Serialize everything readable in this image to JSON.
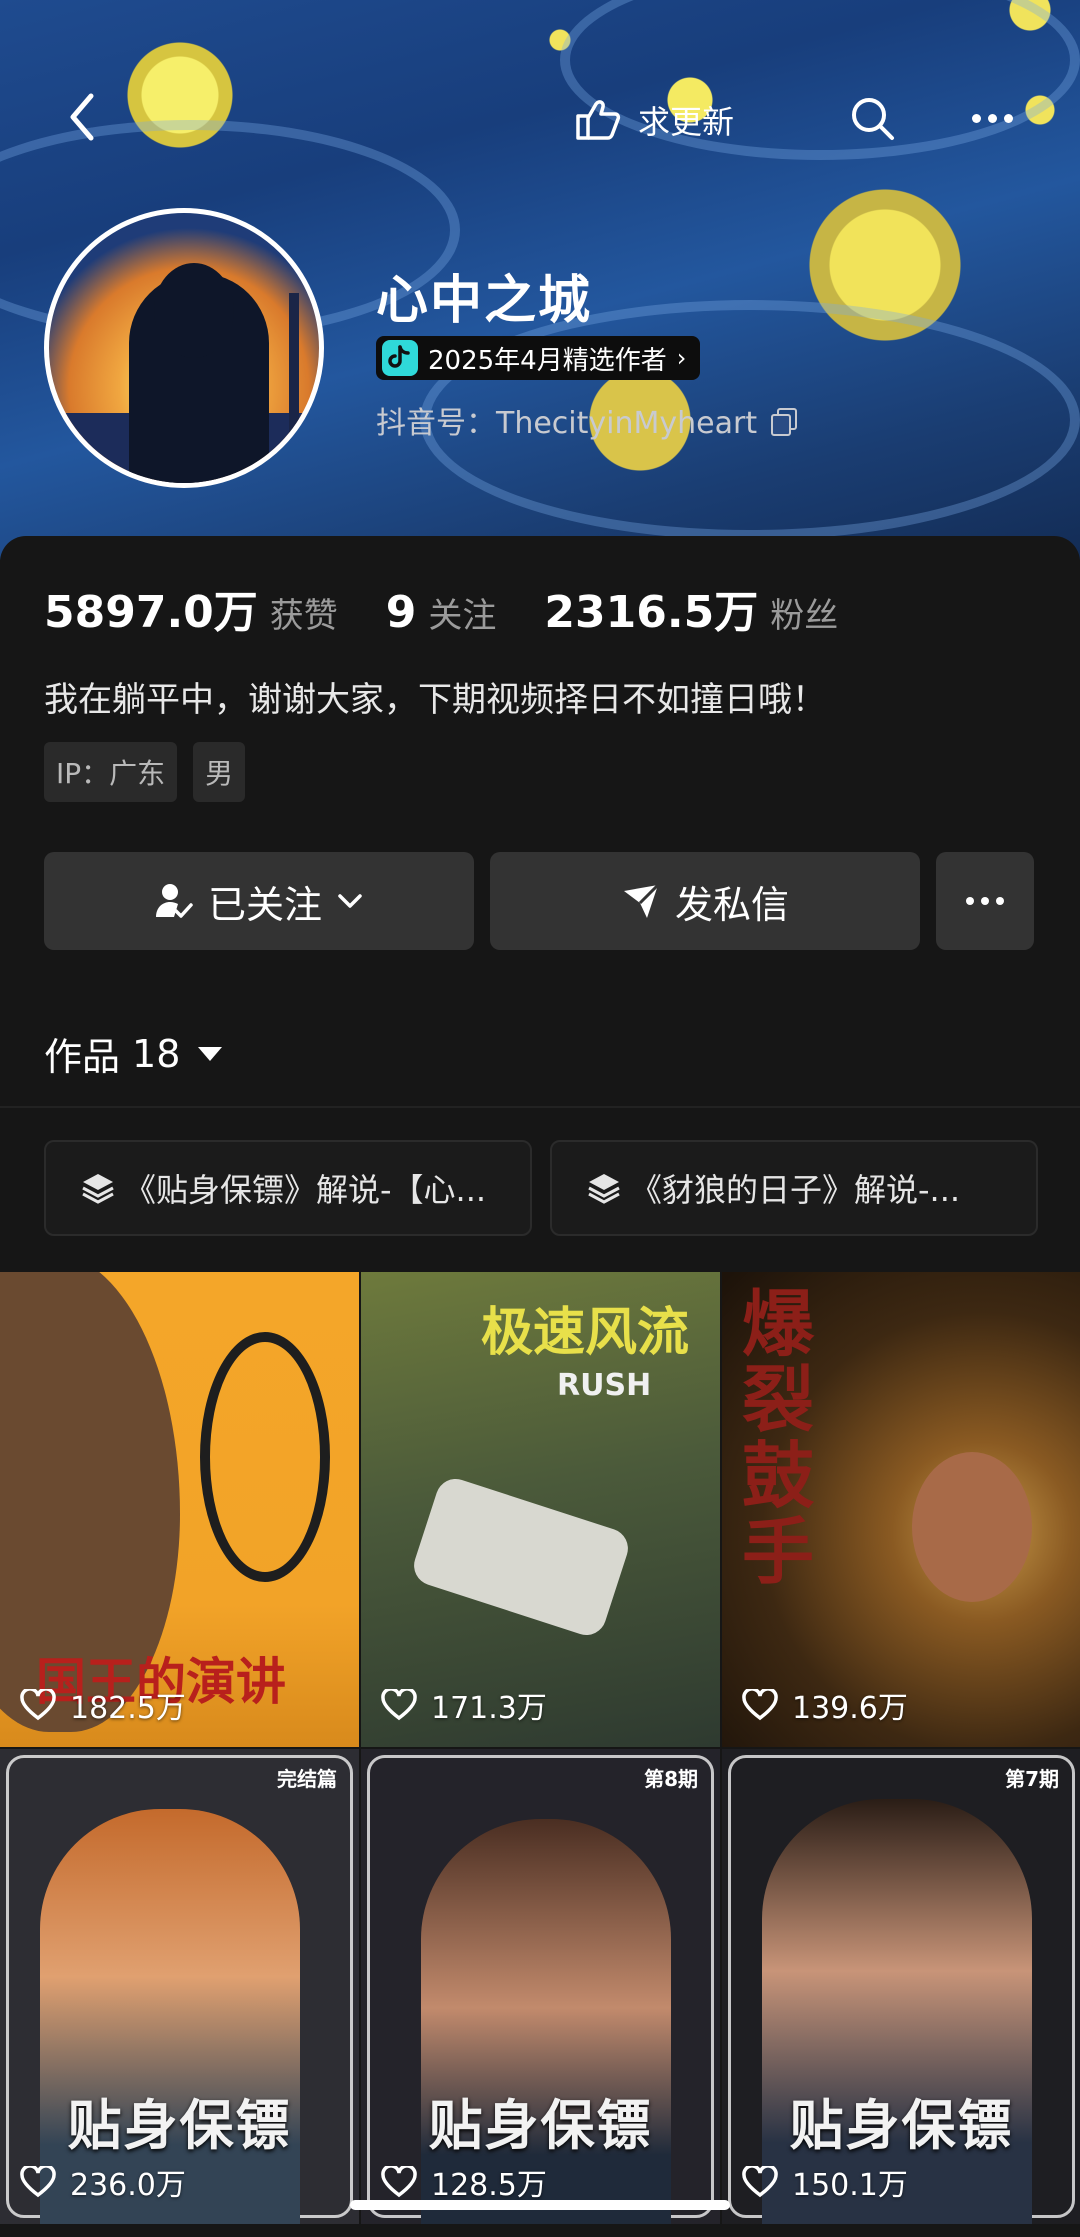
{
  "header": {
    "update_label": "求更新",
    "name": "心中之城",
    "badge_label": "2025年4月精选作者",
    "douyin_id": "抖音号：ThecityinMyheart"
  },
  "stats": {
    "likes_value": "5897.0万",
    "likes_label": "获赞",
    "following_value": "9",
    "following_label": "关注",
    "fans_value": "2316.5万",
    "fans_label": "粉丝"
  },
  "bio": "我在躺平中，谢谢大家，下期视频择日不如撞日哦！",
  "tags": [
    "IP：广东",
    "男"
  ],
  "buttons": {
    "follow_label": "已关注",
    "message_label": "发私信"
  },
  "works": {
    "label": "作品",
    "count": "18"
  },
  "collections": [
    "《贴身保镖》解说-【心...",
    "《豺狼的日子》解说-..."
  ],
  "videos": [
    {
      "likes": "182.5万",
      "title": "国王的演讲"
    },
    {
      "likes": "171.3万",
      "title": "极速风流",
      "subtitle": "RUSH"
    },
    {
      "likes": "139.6万",
      "title": "爆裂鼓手"
    },
    {
      "likes": "236.0万",
      "title": "贴身保镖",
      "episode": "完结篇"
    },
    {
      "likes": "128.5万",
      "title": "贴身保镖",
      "episode": "第8期"
    },
    {
      "likes": "150.1万",
      "title": "贴身保镖",
      "episode": "第7期"
    }
  ],
  "colors": {
    "background": "#161616",
    "button": "#333333",
    "badge_icon": "#2fd9d9"
  }
}
